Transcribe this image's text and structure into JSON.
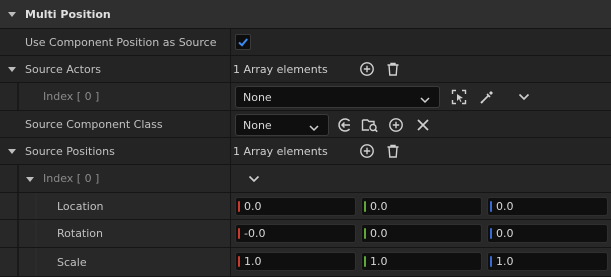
{
  "section": {
    "title": "Multi Position"
  },
  "use_component_position": {
    "label": "Use Component Position as Source",
    "checked": true
  },
  "source_actors": {
    "label": "Source Actors",
    "count_text": "1 Array elements",
    "index_label": "Index [ 0 ]",
    "value": "None"
  },
  "source_component_class": {
    "label": "Source Component Class",
    "value": "None"
  },
  "source_positions": {
    "label": "Source Positions",
    "count_text": "1 Array elements",
    "index_label": "Index [ 0 ]",
    "location": {
      "label": "Location",
      "x": "0.0",
      "y": "0.0",
      "z": "0.0"
    },
    "rotation": {
      "label": "Rotation",
      "x": "-0.0",
      "y": "0.0",
      "z": "0.0"
    },
    "scale": {
      "label": "Scale",
      "x": "1.0",
      "y": "1.0",
      "z": "1.0"
    }
  },
  "colors": {
    "x_axis": "#c83a2e",
    "y_axis": "#5fa83a",
    "z_axis": "#3a6ad0",
    "checkbox_accent": "#3d8bf2"
  }
}
